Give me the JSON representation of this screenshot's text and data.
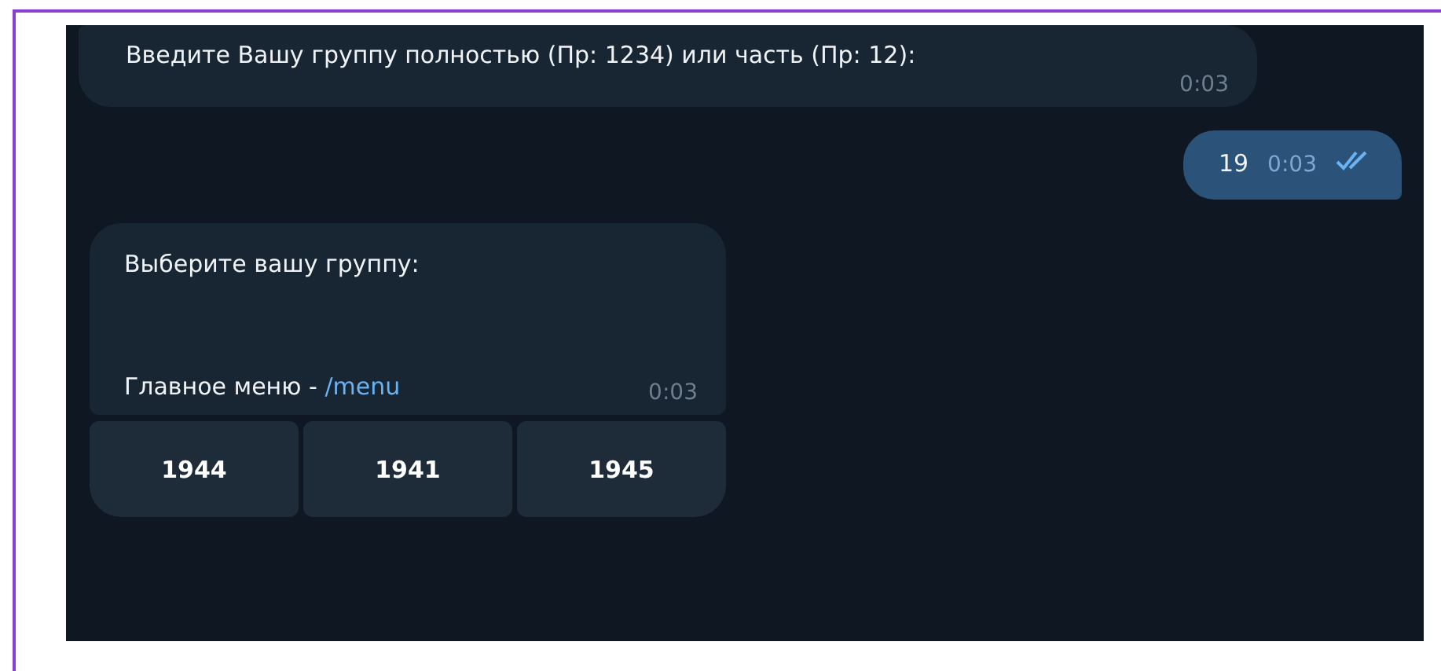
{
  "messages": [
    {
      "kind": "incoming",
      "text": "Введите Вашу группу полностью (Пр: 1234) или часть (Пр: 12):",
      "time": "0:03"
    },
    {
      "kind": "outgoing",
      "text": "19",
      "time": "0:03",
      "read": true
    },
    {
      "kind": "keyboard",
      "text": "Выберите вашу группу:",
      "footer": "Главное меню - ",
      "link": "/menu",
      "time": "0:03",
      "keyboard": [
        "1944",
        "1941",
        "1945"
      ]
    }
  ]
}
